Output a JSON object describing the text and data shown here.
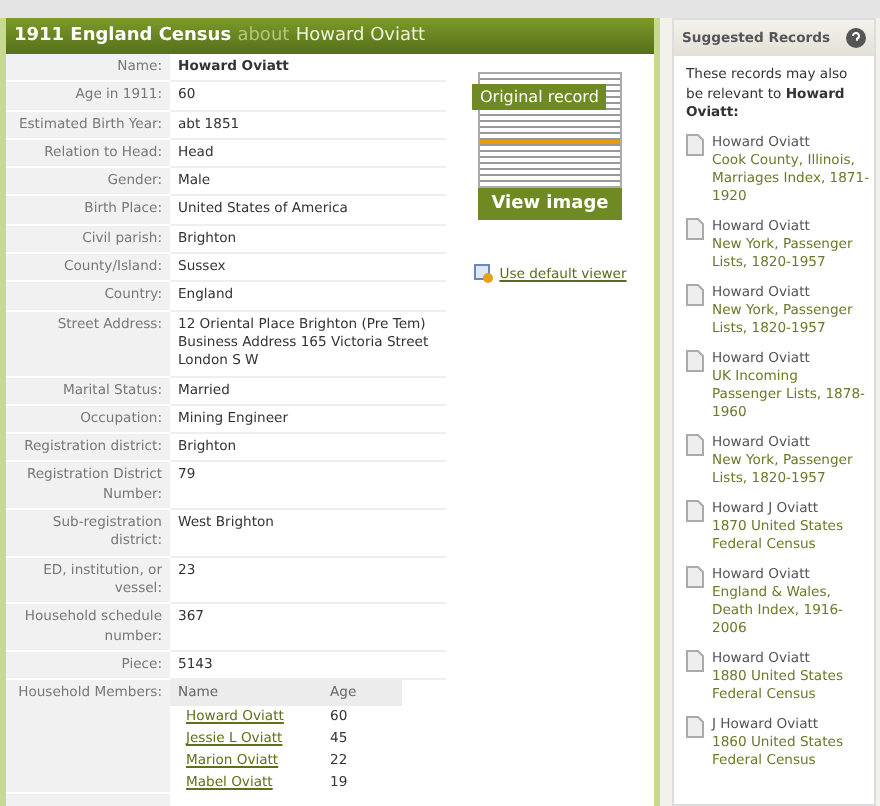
{
  "header": {
    "title": "1911 England Census",
    "about": "about",
    "name": "Howard Oviatt"
  },
  "fields": [
    {
      "label": "Name:",
      "value": "Howard Oviatt"
    },
    {
      "label": "Age in 1911:",
      "value": "60"
    },
    {
      "label": "Estimated Birth Year:",
      "value": "abt 1851"
    },
    {
      "label": "Relation to Head:",
      "value": "Head"
    },
    {
      "label": "Gender:",
      "value": "Male"
    },
    {
      "label": "Birth Place:",
      "value": "United States of America"
    },
    {
      "label": "Civil parish:",
      "value": "Brighton"
    },
    {
      "label": "County/Island:",
      "value": "Sussex"
    },
    {
      "label": "Country:",
      "value": "England"
    },
    {
      "label": "Street Address:",
      "value": "12 Oriental Place Brighton (Pre Tem) Business Address 165 Victoria Street London S W"
    },
    {
      "label": "Marital Status:",
      "value": "Married"
    },
    {
      "label": "Occupation:",
      "value": "Mining Engineer"
    },
    {
      "label": "Registration district:",
      "value": "Brighton"
    },
    {
      "label": "Registration District Number:",
      "value": "79"
    },
    {
      "label": "Sub-registration district:",
      "value": "West Brighton"
    },
    {
      "label": "ED, institution, or vessel:",
      "value": "23"
    },
    {
      "label": "Household schedule number:",
      "value": "367"
    },
    {
      "label": "Piece:",
      "value": "5143"
    }
  ],
  "household": {
    "label": "Household Members:",
    "columns": [
      "Name",
      "Age"
    ],
    "rows": [
      {
        "name": "Howard Oviatt",
        "age": "60"
      },
      {
        "name": "Jessie L Oviatt",
        "age": "45"
      },
      {
        "name": "Marion Oviatt",
        "age": "22"
      },
      {
        "name": "Mabel Oviatt",
        "age": "19"
      }
    ]
  },
  "image": {
    "caption": "Original record",
    "button": "View image",
    "viewer_link": "Use default viewer"
  },
  "suggested": {
    "title": "Suggested Records",
    "intro": "These records may also be relevant to **Howard Oviatt:**",
    "records": [
      {
        "name": "Howard Oviatt",
        "collection": "Cook County, Illinois, Marriages Index, 1871-1920"
      },
      {
        "name": "Howard Oviatt",
        "collection": "New York, Passenger Lists, 1820-1957"
      },
      {
        "name": "Howard Oviatt",
        "collection": "New York, Passenger Lists, 1820-1957"
      },
      {
        "name": "Howard Oviatt",
        "collection": "UK Incoming Passenger Lists, 1878-1960"
      },
      {
        "name": "Howard Oviatt",
        "collection": "New York, Passenger Lists, 1820-1957"
      },
      {
        "name": "Howard J Oviatt",
        "collection": "1870 United States Federal Census"
      },
      {
        "name": "Howard Oviatt",
        "collection": "England & Wales, Death Index, 1916-2006"
      },
      {
        "name": "Howard Oviatt",
        "collection": "1880 United States Federal Census"
      },
      {
        "name": "J Howard Oviatt",
        "collection": "1860 United States Federal Census"
      }
    ]
  }
}
